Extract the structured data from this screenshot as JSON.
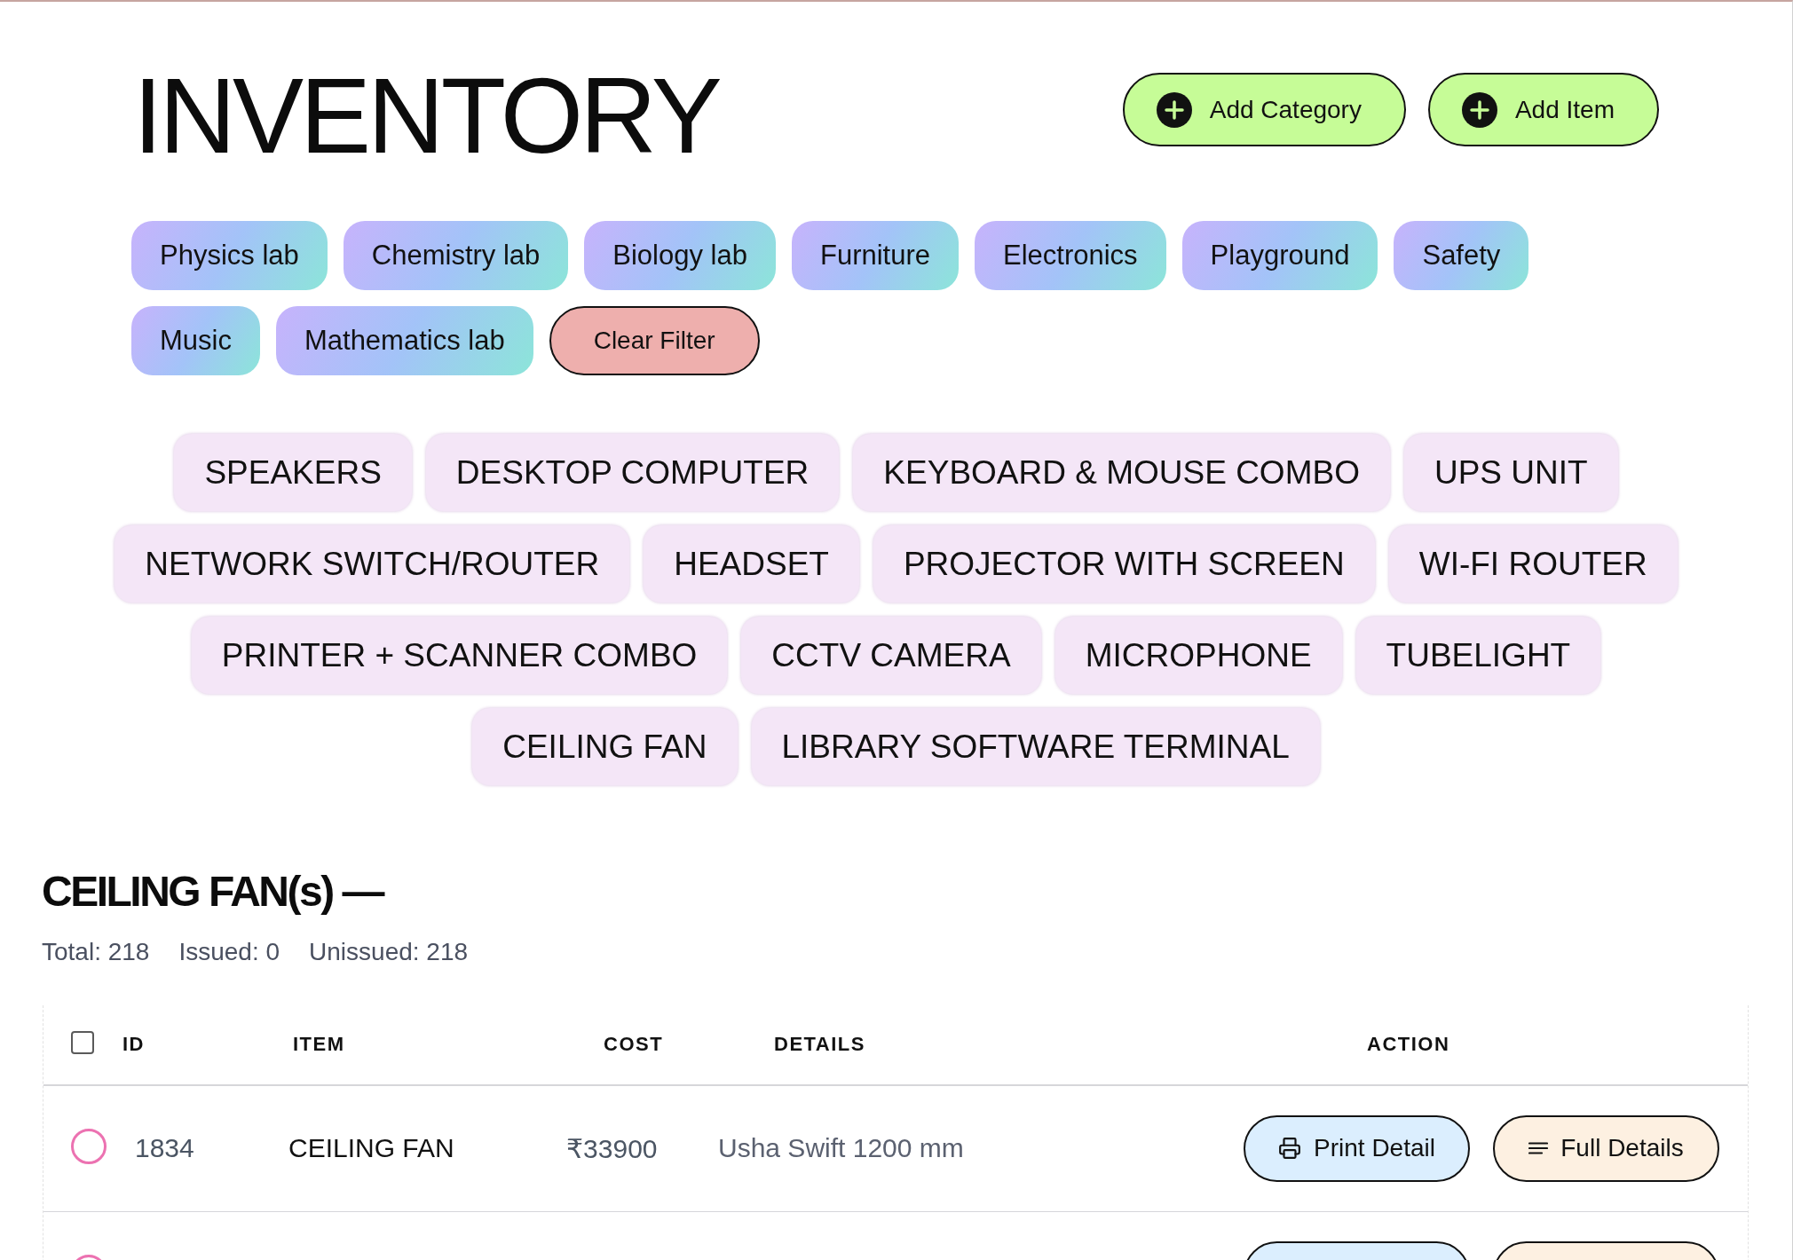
{
  "header": {
    "title": "INVENTORY",
    "buttons": [
      "Add Category",
      "Add Item"
    ]
  },
  "category_filters": {
    "categories": [
      "Physics lab",
      "Chemistry lab",
      "Biology lab",
      "Furniture",
      "Electronics",
      "Playground",
      "Safety",
      "Music",
      "Mathematics lab"
    ],
    "clear_button": "Clear Filter"
  },
  "item_chips": [
    "SPEAKERS",
    "DESKTOP COMPUTER",
    "KEYBOARD & MOUSE COMBO",
    "UPS UNIT",
    "NETWORK SWITCH/ROUTER",
    "HEADSET",
    "PROJECTOR WITH SCREEN",
    "WI-FI ROUTER",
    "PRINTER + SCANNER COMBO",
    "CCTV CAMERA",
    "MICROPHONE",
    "TUBELIGHT",
    "CEILING FAN",
    "LIBRARY SOFTWARE TERMINAL"
  ],
  "section": {
    "heading": "CEILING FAN(s) —",
    "stats": [
      "Total: 218",
      "Issued: 0",
      "Unissued: 218"
    ]
  },
  "table": {
    "select_all": {
      "checked": false
    },
    "columns": [
      "ID",
      "ITEM",
      "COST",
      "DETAILS",
      "ACTION"
    ],
    "rows": [
      {
        "selected": false,
        "id": "1834",
        "item": "CEILING FAN",
        "cost": "₹33900",
        "details": "Usha Swift 1200 mm",
        "actions": [
          {
            "kind": "print",
            "label": "Print Detail"
          },
          {
            "kind": "details",
            "label": "Full Details"
          }
        ]
      },
      {
        "selected": false,
        "actions": [
          {
            "kind": "print"
          },
          {
            "kind": "details"
          }
        ]
      }
    ]
  }
}
